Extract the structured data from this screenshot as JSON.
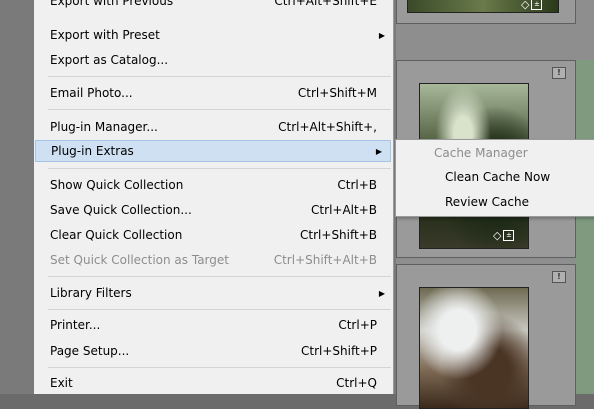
{
  "menu": {
    "items": [
      {
        "label": "Export with Previous",
        "shortcut": "Ctrl+Alt+Shift+E"
      },
      {
        "label": "Export with Preset",
        "submenu": true
      },
      {
        "label": "Export as Catalog..."
      },
      {
        "label": "Email Photo...",
        "shortcut": "Ctrl+Shift+M"
      },
      {
        "label": "Plug-in Manager...",
        "shortcut": "Ctrl+Alt+Shift+,"
      },
      {
        "label": "Plug-in Extras",
        "submenu": true,
        "highlighted": true
      },
      {
        "label": "Show Quick Collection",
        "shortcut": "Ctrl+B"
      },
      {
        "label": "Save Quick Collection...",
        "shortcut": "Ctrl+Alt+B"
      },
      {
        "label": "Clear Quick Collection",
        "shortcut": "Ctrl+Shift+B"
      },
      {
        "label": "Set Quick Collection as Target",
        "shortcut": "Ctrl+Shift+Alt+B",
        "disabled": true
      },
      {
        "label": "Library Filters",
        "submenu": true
      },
      {
        "label": "Printer...",
        "shortcut": "Ctrl+P"
      },
      {
        "label": "Page Setup...",
        "shortcut": "Ctrl+Shift+P"
      },
      {
        "label": "Exit",
        "shortcut": "Ctrl+Q"
      }
    ]
  },
  "submenu": {
    "header": "Cache Manager",
    "items": [
      {
        "label": "Clean Cache Now"
      },
      {
        "label": "Review Cache"
      }
    ]
  },
  "thumbnails": {
    "badge": "!",
    "icons": [
      "tag-icon",
      "edit-badge-icon"
    ]
  },
  "colors": {
    "menu_bg": "#f0f0f0",
    "highlight_bg": "#cfe0f3",
    "highlight_border": "#a6c4e6",
    "disabled_text": "#8d8d8d"
  }
}
